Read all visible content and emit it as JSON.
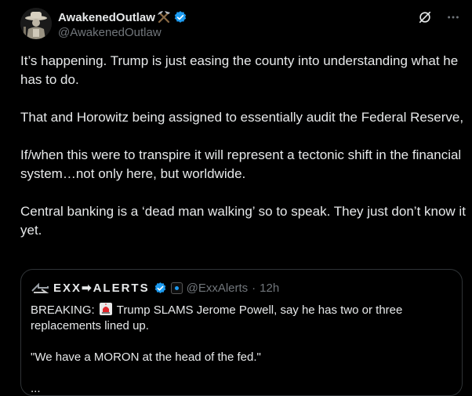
{
  "author": {
    "display_name": "AwakenedOutlaw",
    "handle": "@AwakenedOutlaw",
    "emoji_icon": "hammer-and-pick-icon",
    "verified": true
  },
  "colors": {
    "background": "#000000",
    "text": "#e7e9ea",
    "muted": "#71767b",
    "verified_blue": "#1d9bf0",
    "border": "#2f3336"
  },
  "actions": {
    "grok_icon": "grok-icon",
    "more_icon": "more-dots-icon"
  },
  "tweet": {
    "paragraphs": [
      "It’s happening.  Trump is just easing the county into understanding what he has to do.",
      "That and Horowitz being assigned to essentially audit the Federal Reserve,",
      "If/when this were to transpire it will represent a tectonic shift in the financial system…not only here, but worldwide.",
      "Central banking is a ‘dead man walking’ so to speak. They just don’t know it yet."
    ]
  },
  "quote": {
    "display_name": "EXX➡ALERTS",
    "handle": "@ExxAlerts",
    "separator": "·",
    "time": "12h",
    "line1_prefix": "BREAKING:",
    "line1_emoji": "siren-icon",
    "line1_rest": "Trump SLAMS Jerome Powell, say he has two or three replacements lined up.",
    "line2": "\"We have a MORON at the head of the fed.\"",
    "line3": "..."
  }
}
